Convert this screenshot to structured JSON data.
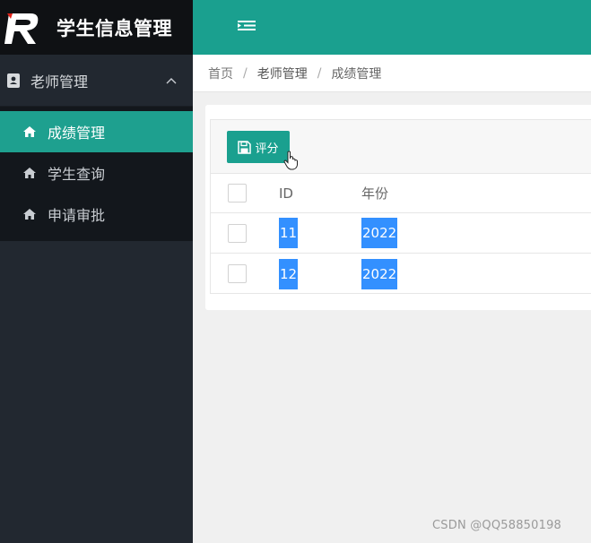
{
  "sidebar": {
    "app_title": "学生信息管理",
    "group_label": "老师管理",
    "items": [
      {
        "label": "成绩管理",
        "active": true
      },
      {
        "label": "学生查询",
        "active": false
      },
      {
        "label": "申请审批",
        "active": false
      }
    ]
  },
  "breadcrumb": [
    "首页",
    "老师管理",
    "成绩管理"
  ],
  "toolbar": {
    "score_label": "评分"
  },
  "table": {
    "headers": [
      "ID",
      "年份"
    ],
    "rows": [
      {
        "id": "11",
        "year": "2022"
      },
      {
        "id": "12",
        "year": "2022"
      }
    ]
  },
  "watermark": "CSDN @QQ58850198",
  "colors": {
    "accent": "#1aa08f",
    "sidebar": "#222830",
    "selection": "#3390ff"
  },
  "icons": {
    "logo": "r-logo-icon",
    "group": "contact-book-icon",
    "chevron": "chevron-up-icon",
    "item": "home-icon",
    "toggle": "menu-toggle-icon",
    "button": "save-icon"
  }
}
